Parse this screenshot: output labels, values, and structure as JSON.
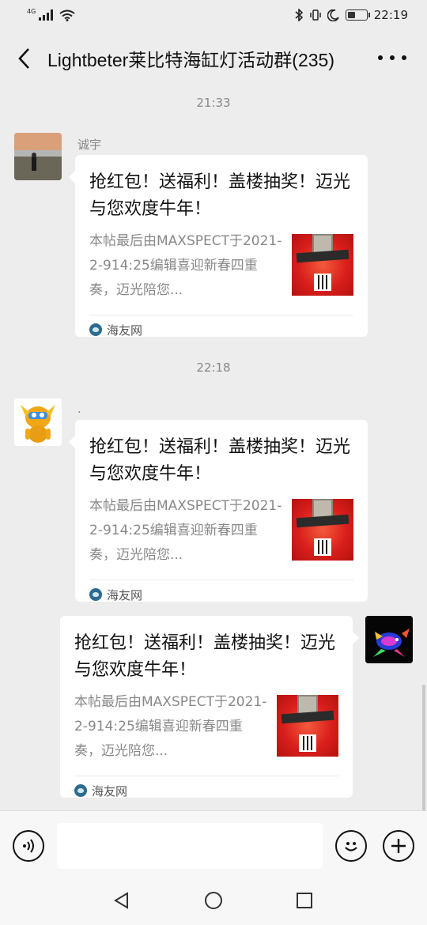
{
  "status_bar": {
    "network": "4G",
    "time": "22:19",
    "battery_level": 0.4
  },
  "header": {
    "title": "Lightbeter莱比特海缸灯活动群(235)"
  },
  "messages": [
    {
      "timestamp": "21:33",
      "sender": "诚宇",
      "side": "left",
      "card": {
        "title": "抢红包！送福利！盖楼抽奖！迈光与您欢度牛年！",
        "description": "本帖最后由MAXSPECT于2021-2-914:25编辑喜迎新春四重奏，迈光陪您...",
        "source": "海友网"
      }
    },
    {
      "timestamp": "22:18",
      "sender": ".",
      "side": "left",
      "card": {
        "title": "抢红包！送福利！盖楼抽奖！迈光与您欢度牛年！",
        "description": "本帖最后由MAXSPECT于2021-2-914:25编辑喜迎新春四重奏，迈光陪您...",
        "source": "海友网"
      }
    },
    {
      "side": "right",
      "card": {
        "title": "抢红包！送福利！盖楼抽奖！迈光与您欢度牛年！",
        "description": "本帖最后由MAXSPECT于2021-2-914:25编辑喜迎新春四重奏，迈光陪您...",
        "source": "海友网"
      }
    }
  ],
  "input": {
    "placeholder": ""
  },
  "icons": {
    "voice": "voice-icon",
    "emoji": "emoji-icon",
    "add": "plus-icon"
  }
}
